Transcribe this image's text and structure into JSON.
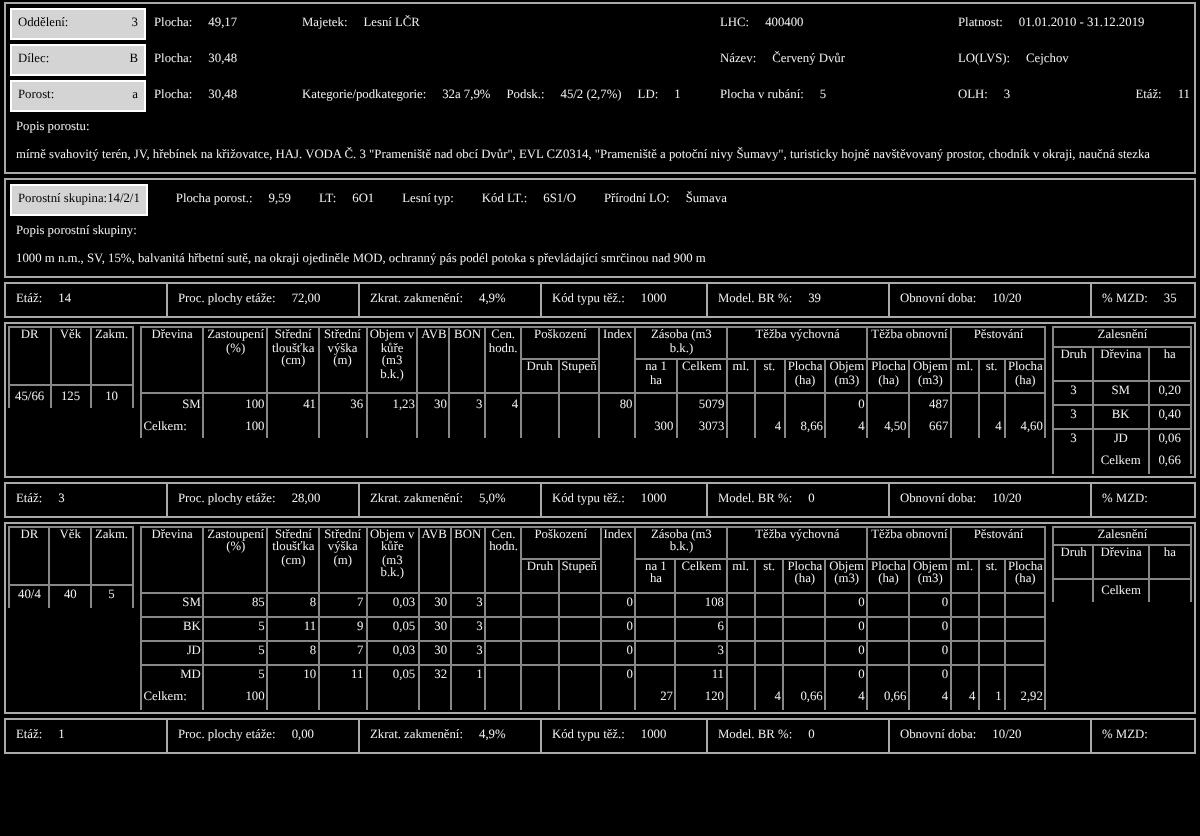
{
  "stand": {
    "rows": [
      {
        "box": {
          "label": "Oddělení:",
          "value": "3"
        },
        "area": {
          "label": "Plocha:",
          "value": "49,17"
        },
        "middle": [
          {
            "label": "Majetek:",
            "value": "Lesní LČR"
          }
        ],
        "col3": [
          {
            "label": "LHC:",
            "value": "400400"
          }
        ],
        "col4": [
          {
            "label": "Platnost:",
            "value": "01.01.2010 - 31.12.2019"
          }
        ]
      },
      {
        "box": {
          "label": "Dílec:",
          "value": "B"
        },
        "area": {
          "label": "Plocha:",
          "value": "30,48"
        },
        "middle": [],
        "col3": [
          {
            "label": "Název:",
            "value": "Červený Dvůr"
          }
        ],
        "col4": [
          {
            "label": "LO(LVS):",
            "value": "Cejchov"
          }
        ]
      },
      {
        "box": {
          "label": "Porost:",
          "value": "a"
        },
        "area": {
          "label": "Plocha:",
          "value": "30,48"
        },
        "middle": [
          {
            "label": "Kategorie/podkategorie:",
            "value": "32a 7,9%"
          },
          {
            "label": "Podsk.:",
            "value": "45/2 (2,7%)"
          },
          {
            "label": "LD:",
            "value": "1"
          }
        ],
        "col3": [
          {
            "label": "Plocha v rubání:",
            "value": "5"
          }
        ],
        "col4": [
          {
            "label": "OLH:",
            "value": "3"
          },
          {
            "label": "Etáž:",
            "value": "11"
          }
        ]
      }
    ],
    "description_label": "Popis porostu:",
    "description": "mírně svahovitý terén, JV, hřebínek na křižovatce, HAJ. VODA Č. 3 \"Prameniště nad obcí Dvůr\", EVL CZ0314, \"Prameniště a potoční nivy Šumavy\", turisticky hojně navštěvovaný prostor, chodník v okraji, naučná stezka"
  },
  "group": {
    "box": {
      "label": "Porostní skupina:",
      "value": "14/2/1"
    },
    "fields": [
      {
        "label": "Plocha porost.:",
        "value": "9,59"
      },
      {
        "label": "LT:",
        "value": "6O1"
      },
      {
        "label": "Lesní typ:"
      },
      {
        "label": "Kód LT.:",
        "value": "6S1/O"
      },
      {
        "label": "Přírodní LO:",
        "value": "Šumava"
      }
    ],
    "description_label": "Popis porostní skupiny:",
    "description": "1000 m n.m., SV, 15%, balvanitá hřbetní sutě, na okraji ojediněle MOD, ochranný pás podél potoka s převládající smrčinou nad 900 m"
  },
  "storeys": [
    {
      "bar": [
        {
          "label": "Etáž:",
          "value": "14"
        },
        {
          "label": "Proc. plochy etáže:",
          "value": "72,00"
        },
        {
          "label": "Zkrat. zakmenění:",
          "value": "4,9%"
        },
        {
          "label": "Kód typu těž.:",
          "value": "1000"
        },
        {
          "label": "Model. BR %:",
          "value": "39"
        },
        {
          "label": "Obnovní doba:",
          "value": "10/20"
        },
        {
          "label": "% MZD:",
          "value": "35"
        }
      ],
      "left_columns": [
        "DR",
        "Věk",
        "Zakm."
      ],
      "left_values": [
        "45/66",
        "125",
        "10"
      ],
      "column_groups": [
        "Poškození",
        "Zásoba (m3 b.k.)",
        "Těžba výchovná",
        "Těžba obnovní",
        "Pěstování"
      ],
      "columns": [
        {
          "label": "Dřevina"
        },
        {
          "label": "Zastoupení (%)"
        },
        {
          "label": "Střední tloušťka (cm)"
        },
        {
          "label": "Střední výška (m)"
        },
        {
          "label": "Objem v kůře (m3 b.k.)"
        },
        {
          "label": "AVB"
        },
        {
          "label": "BON"
        },
        {
          "label": "Cen. hodn."
        },
        {
          "label": "Druh",
          "grouped": true,
          "group_start": true
        },
        {
          "label": "Stupeň",
          "grouped": true
        },
        {
          "label": "Index"
        },
        {
          "label": "na 1 ha",
          "grouped": true,
          "group_start": true
        },
        {
          "label": "Celkem",
          "grouped": true
        },
        {
          "label": "ml.",
          "grouped": true,
          "group_start": true
        },
        {
          "label": "st.",
          "grouped": true
        },
        {
          "label": "Plocha (ha)",
          "grouped": true
        },
        {
          "label": "Objem (m3)",
          "grouped": true
        },
        {
          "label": "Plocha (ha)",
          "grouped": true,
          "group_start": true
        },
        {
          "label": "Objem (m3)",
          "grouped": true
        },
        {
          "label": "ml.",
          "grouped": true,
          "group_start": true
        },
        {
          "label": "st.",
          "grouped": true
        },
        {
          "label": "Plocha (ha)",
          "grouped": true
        }
      ],
      "rows": [
        {
          "kind": "species",
          "cells": [
            "SM",
            "100",
            "41",
            "36",
            "1,23",
            "30",
            "3",
            "4",
            null,
            null,
            "80",
            null,
            "5079",
            null,
            null,
            null,
            "0",
            null,
            "487",
            null,
            null,
            null
          ]
        },
        {
          "kind": "total",
          "cells": [
            "Celkem:",
            "100",
            null,
            null,
            null,
            null,
            null,
            null,
            null,
            null,
            null,
            "300",
            "3073",
            null,
            "4",
            "8,66",
            "4",
            "4,50",
            "667",
            null,
            "4",
            "4,60"
          ]
        }
      ],
      "planting": {
        "label": "Zalesnění",
        "columns": [
          "Druh",
          "Dřevina",
          "ha"
        ],
        "rows": [
          {
            "kind": "item",
            "cells": [
              "3",
              "SM",
              "0,20"
            ]
          },
          {
            "kind": "item",
            "cells": [
              "3",
              "BK",
              "0,40"
            ]
          },
          {
            "kind": "item",
            "cells": [
              "3",
              "JD",
              "0,06"
            ]
          },
          {
            "kind": "total",
            "cells": [
              null,
              "Celkem",
              "0,66"
            ]
          }
        ]
      }
    },
    {
      "bar": [
        {
          "label": "Etáž:",
          "value": "3"
        },
        {
          "label": "Proc. plochy etáže:",
          "value": "28,00"
        },
        {
          "label": "Zkrat. zakmenění:",
          "value": "5,0%"
        },
        {
          "label": "Kód typu těž.:",
          "value": "1000"
        },
        {
          "label": "Model. BR %:",
          "value": "0"
        },
        {
          "label": "Obnovní doba:",
          "value": "10/20"
        },
        {
          "label": "% MZD:"
        }
      ],
      "left_columns": [
        "DR",
        "Věk",
        "Zakm."
      ],
      "left_values": [
        "40/4",
        "40",
        "5"
      ],
      "column_groups": [
        "Poškození",
        "Zásoba (m3 b.k.)",
        "Těžba výchovná",
        "Těžba obnovní",
        "Pěstování"
      ],
      "columns": [
        {
          "label": "Dřevina"
        },
        {
          "label": "Zastoupení (%)"
        },
        {
          "label": "Střední tloušťka (cm)"
        },
        {
          "label": "Střední výška (m)"
        },
        {
          "label": "Objem v kůře (m3 b.k.)"
        },
        {
          "label": "AVB"
        },
        {
          "label": "BON"
        },
        {
          "label": "Cen. hodn."
        },
        {
          "label": "Druh",
          "grouped": true,
          "group_start": true
        },
        {
          "label": "Stupeň",
          "grouped": true
        },
        {
          "label": "Index"
        },
        {
          "label": "na 1 ha",
          "grouped": true,
          "group_start": true
        },
        {
          "label": "Celkem",
          "grouped": true
        },
        {
          "label": "ml.",
          "grouped": true,
          "group_start": true
        },
        {
          "label": "st.",
          "grouped": true
        },
        {
          "label": "Plocha (ha)",
          "grouped": true
        },
        {
          "label": "Objem (m3)",
          "grouped": true
        },
        {
          "label": "Plocha (ha)",
          "grouped": true,
          "group_start": true
        },
        {
          "label": "Objem (m3)",
          "grouped": true
        },
        {
          "label": "ml.",
          "grouped": true,
          "group_start": true
        },
        {
          "label": "st.",
          "grouped": true
        },
        {
          "label": "Plocha (ha)",
          "grouped": true
        }
      ],
      "rows": [
        {
          "kind": "species",
          "cells": [
            "SM",
            "85",
            "8",
            "7",
            "0,03",
            "30",
            "3",
            null,
            null,
            null,
            "0",
            null,
            "108",
            null,
            null,
            null,
            "0",
            null,
            "0",
            null,
            null,
            null
          ]
        },
        {
          "kind": "species",
          "cells": [
            "BK",
            "5",
            "11",
            "9",
            "0,05",
            "30",
            "3",
            null,
            null,
            null,
            "0",
            null,
            "6",
            null,
            null,
            null,
            "0",
            null,
            "0",
            null,
            null,
            null
          ]
        },
        {
          "kind": "species",
          "cells": [
            "JD",
            "5",
            "8",
            "7",
            "0,03",
            "30",
            "3",
            null,
            null,
            null,
            "0",
            null,
            "3",
            null,
            null,
            null,
            "0",
            null,
            "0",
            null,
            null,
            null
          ]
        },
        {
          "kind": "species",
          "cells": [
            "MD",
            "5",
            "10",
            "11",
            "0,05",
            "32",
            "1",
            null,
            null,
            null,
            "0",
            null,
            "11",
            null,
            null,
            null,
            "0",
            null,
            "0",
            null,
            null,
            null
          ]
        },
        {
          "kind": "total",
          "cells": [
            "Celkem:",
            "100",
            null,
            null,
            null,
            null,
            null,
            null,
            null,
            null,
            null,
            "27",
            "120",
            null,
            "4",
            "0,66",
            "4",
            "0,66",
            "4",
            "4",
            "1",
            "2,92"
          ]
        }
      ],
      "planting": {
        "label": "Zalesnění",
        "columns": [
          "Druh",
          "Dřevina",
          "ha"
        ],
        "rows": [
          {
            "kind": "total",
            "cells": [
              null,
              "Celkem",
              null
            ]
          }
        ]
      }
    },
    {
      "bar": [
        {
          "label": "Etáž:",
          "value": "1"
        },
        {
          "label": "Proc. plochy etáže:",
          "value": "0,00"
        },
        {
          "label": "Zkrat. zakmenění:",
          "value": "4,9%"
        },
        {
          "label": "Kód typu těž.:",
          "value": "1000"
        },
        {
          "label": "Model. BR %:",
          "value": "0"
        },
        {
          "label": "Obnovní doba:",
          "value": "10/20"
        },
        {
          "label": "% MZD:"
        }
      ]
    }
  ]
}
